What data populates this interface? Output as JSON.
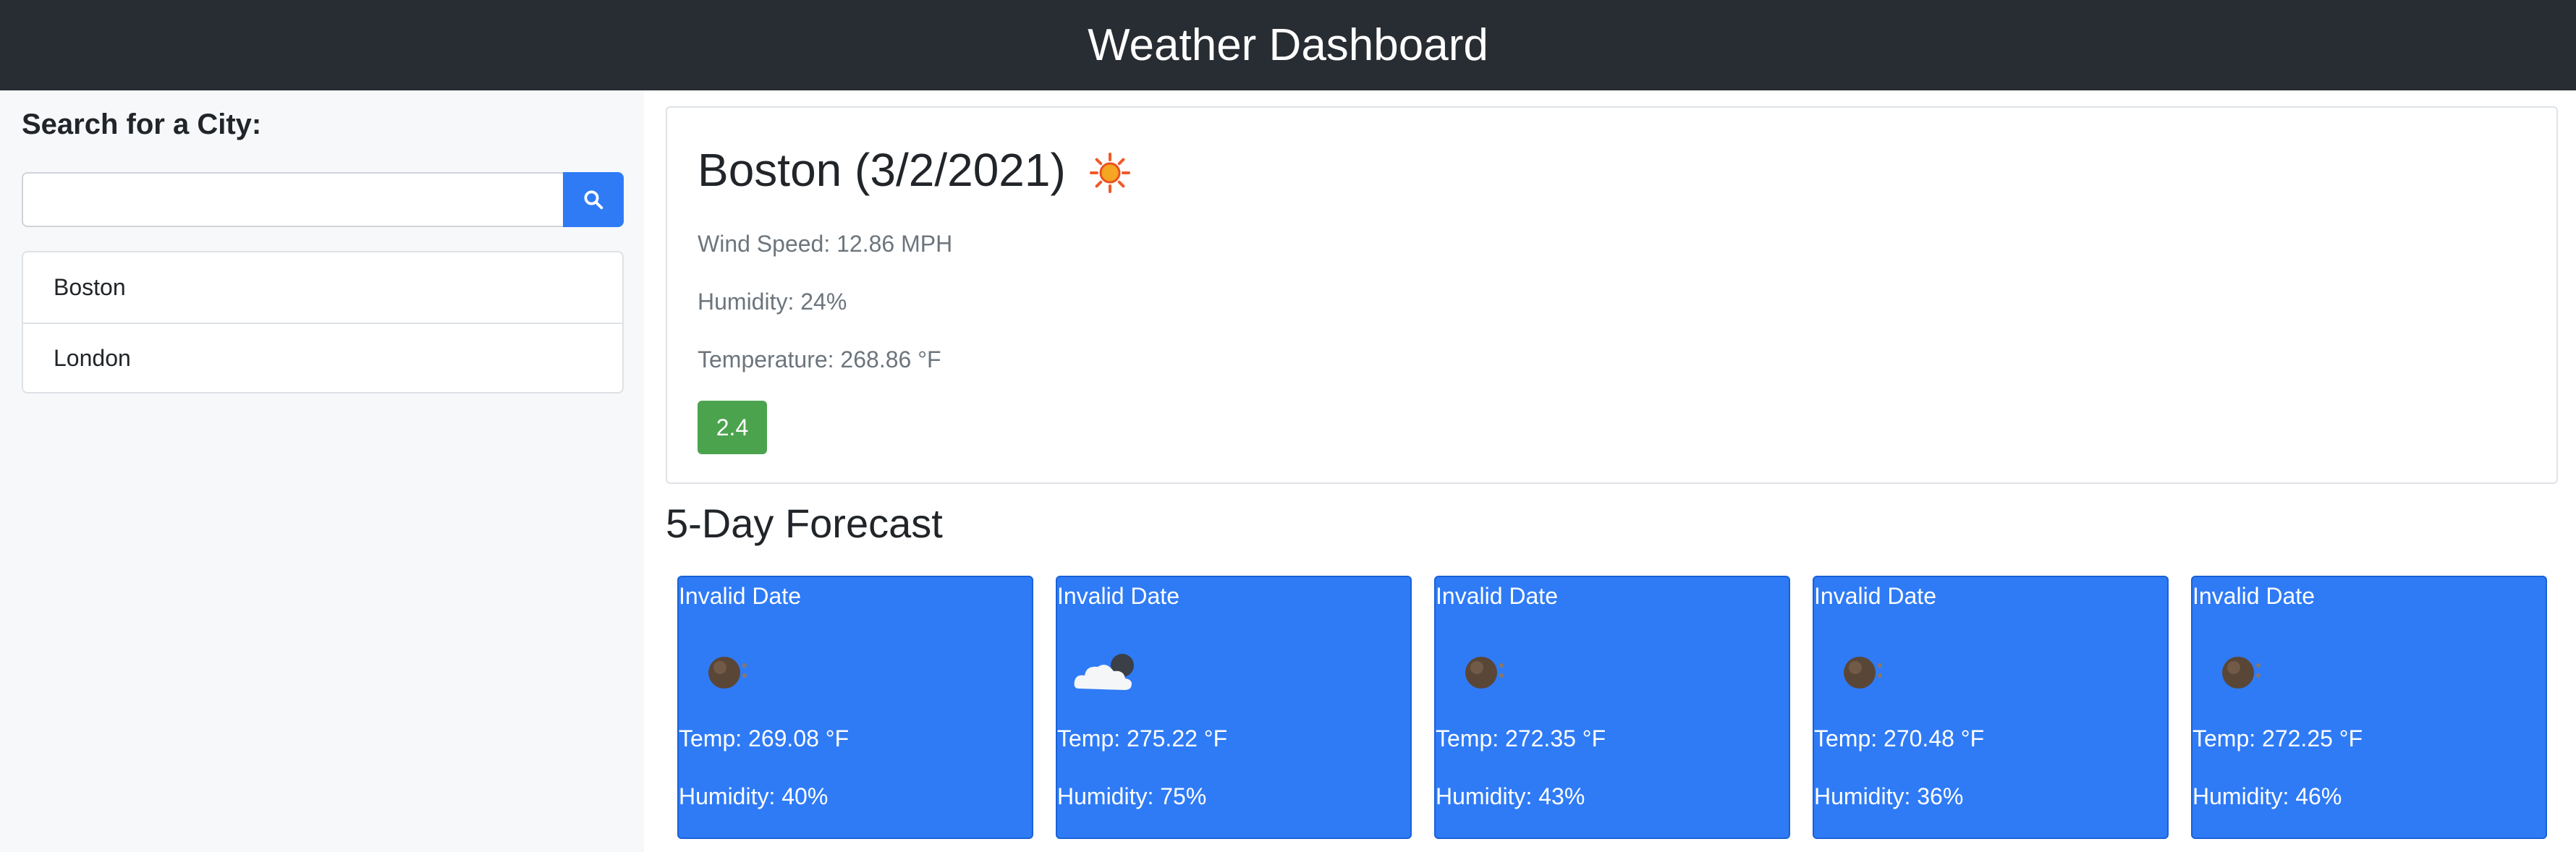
{
  "header": {
    "title": "Weather Dashboard"
  },
  "sidebar": {
    "title": "Search for a City:",
    "search": {
      "value": "",
      "placeholder": "",
      "button_icon": "search-icon"
    },
    "cities": [
      {
        "label": "Boston"
      },
      {
        "label": "London"
      }
    ]
  },
  "current": {
    "title": "Boston (3/2/2021)",
    "icon": "sun-icon",
    "wind": "Wind Speed: 12.86 MPH",
    "humidity": "Humidity: 24%",
    "temperature": "Temperature: 268.86 °F",
    "uv_index": "2.4",
    "uv_color": "#4ca34e"
  },
  "forecast": {
    "title": "5-Day Forecast",
    "card_color": "#2f7bf6",
    "days": [
      {
        "date": "Invalid Date",
        "icon": "night-clear-icon",
        "temp": "Temp: 269.08 °F",
        "humidity": "Humidity: 40%"
      },
      {
        "date": "Invalid Date",
        "icon": "cloud-icon",
        "temp": "Temp: 275.22 °F",
        "humidity": "Humidity: 75%"
      },
      {
        "date": "Invalid Date",
        "icon": "night-clear-icon",
        "temp": "Temp: 272.35 °F",
        "humidity": "Humidity: 43%"
      },
      {
        "date": "Invalid Date",
        "icon": "night-clear-icon",
        "temp": "Temp: 270.48 °F",
        "humidity": "Humidity: 36%"
      },
      {
        "date": "Invalid Date",
        "icon": "night-clear-icon",
        "temp": "Temp: 272.25 °F",
        "humidity": "Humidity: 46%"
      }
    ]
  }
}
